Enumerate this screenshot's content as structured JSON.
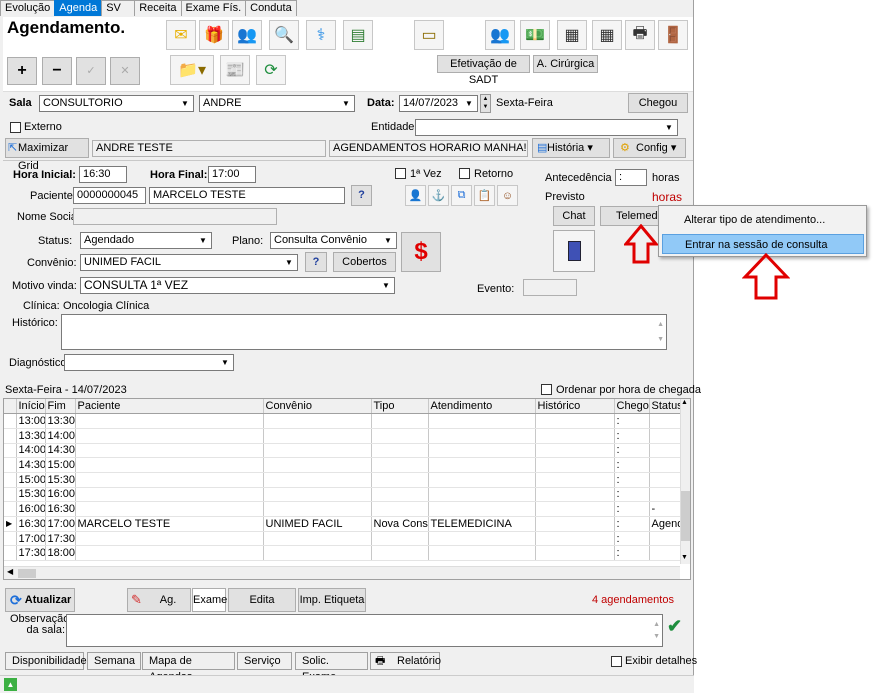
{
  "tabs": [
    "Evolução",
    "Agenda",
    "SV",
    "Receita",
    "Exame Fís.",
    "Conduta"
  ],
  "page_title": "Agendamento.",
  "buttons": {
    "plus": "+",
    "minus": "−",
    "check": "✓",
    "cancel": "✕",
    "efetivacao": "Efetivação de SADT",
    "cirurgica": "A. Cirúrgica",
    "chegou": "Chegou",
    "maximizar": "Maximizar Grid",
    "historia": "História",
    "config": "Config",
    "chat": "Chat",
    "telemed": "Telemedi",
    "cobertos": "Cobertos",
    "atualizar": "Atualizar",
    "ag_eletr": "Ag. Eletr.",
    "exame": "Exame",
    "edita_etiqueta": "Edita Etiqueta",
    "imp_etiqueta": "Imp. Etiqueta"
  },
  "form": {
    "sala_label": "Sala",
    "sala_value": "CONSULTORIO",
    "andre_value": "ANDRE",
    "data_label": "Data:",
    "data_value": "14/07/2023",
    "weekday": "Sexta-Feira",
    "externo_label": "Externo",
    "entidade_label": "Entidade",
    "andre_teste": "ANDRE TESTE",
    "msg": "AGENDAMENTOS HORARIO MANHA!!!!1",
    "hora_inicial_label": "Hora Inicial:",
    "hora_inicial": "16:30",
    "hora_final_label": "Hora Final:",
    "hora_final": "17:00",
    "primeira_vez": "1ª Vez",
    "retorno": "Retorno",
    "antecedencia_label": "Antecedência",
    "antecedencia_value": ":",
    "horas": "horas",
    "previsto_label": "Previsto",
    "previsto_horas": "horas",
    "paciente_label": "Paciente:",
    "paciente_id": "0000000045",
    "paciente_nome": "MARCELO TESTE",
    "nome_social_label": "Nome Social:",
    "status_label": "Status:",
    "status_value": "Agendado",
    "plano_label": "Plano:",
    "plano_value": "Consulta Convênio",
    "convenio_label": "Convênio:",
    "convenio_value": "UNIMED FACIL",
    "motivo_label": "Motivo vinda:",
    "motivo_value": "CONSULTA 1ª VEZ",
    "evento_label": "Evento:",
    "clinica_label": "Clínica:",
    "clinica_value": "Oncologia Clínica",
    "historico_label": "Histórico:",
    "diagnostico_label": "Diagnóstico:",
    "question": "?"
  },
  "grid_section": {
    "date_label": "Sexta-Feira - 14/07/2023",
    "ordenar_label": "Ordenar por hora de chegada",
    "columns": [
      "Início",
      "Fim",
      "Paciente",
      "Convênio",
      "Tipo",
      "Atendimento",
      "Histórico",
      "Chegou",
      "Status"
    ],
    "rows": [
      [
        "13:00",
        "13:30",
        "",
        "",
        "",
        "",
        "",
        ":",
        ""
      ],
      [
        "13:30",
        "14:00",
        "",
        "",
        "",
        "",
        "",
        ":",
        ""
      ],
      [
        "14:00",
        "14:30",
        "",
        "",
        "",
        "",
        "",
        ":",
        ""
      ],
      [
        "14:30",
        "15:00",
        "",
        "",
        "",
        "",
        "",
        ":",
        ""
      ],
      [
        "15:00",
        "15:30",
        "",
        "",
        "",
        "",
        "",
        ":",
        ""
      ],
      [
        "15:30",
        "16:00",
        "",
        "",
        "",
        "",
        "",
        ":",
        ""
      ],
      [
        "16:00",
        "16:30",
        "",
        "",
        "",
        "",
        "",
        ":",
        "-"
      ],
      [
        "16:30",
        "17:00",
        "MARCELO TESTE",
        "UNIMED FACIL",
        "Nova Cons.",
        "TELEMEDICINA",
        "",
        ":",
        "Agend"
      ],
      [
        "17:00",
        "17:30",
        "",
        "",
        "",
        "",
        "",
        ":",
        ""
      ],
      [
        "17:30",
        "18:00",
        "",
        "",
        "",
        "",
        "",
        ":",
        ""
      ]
    ],
    "count": "4 agendamentos"
  },
  "observacao_label": "Observação da sala:",
  "bottom_tabs": [
    "Disponibilidade",
    "Semana",
    "Mapa de Agendas",
    "Serviço",
    "Solic. Exame",
    "Relatório"
  ],
  "exibir_detalhes": "Exibir detalhes",
  "context_menu": [
    "Alterar tipo de atendimento...",
    "Entrar na sessão de consulta"
  ],
  "colors": {
    "accent": "#0078d7",
    "highlight": "#91c9f7",
    "arrow": "#e00000",
    "count": "#c00000"
  }
}
